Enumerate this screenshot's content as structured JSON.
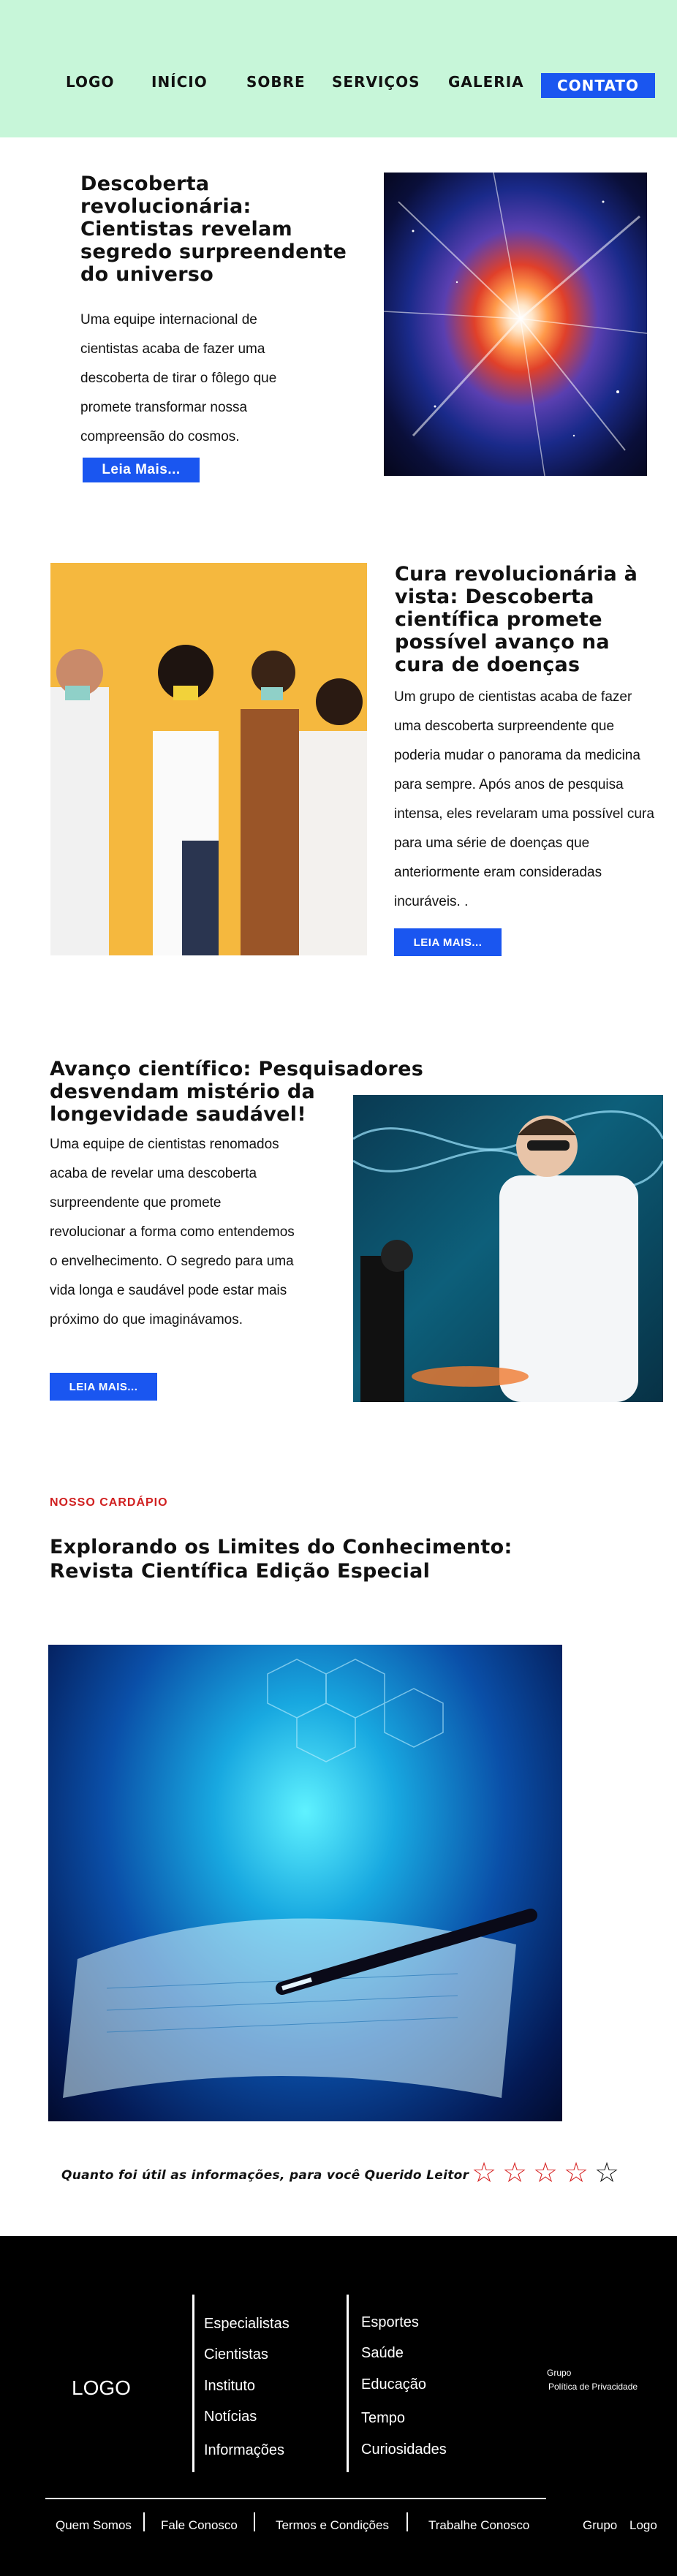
{
  "nav": {
    "logo": "LOGO",
    "items": [
      "INÍCIO",
      "SOBRE",
      "SERVIÇOS",
      "GALERIA"
    ],
    "cta": "CONTATO"
  },
  "articles": [
    {
      "title": "Descoberta revolucionária: Cientistas revelam segredo surpreendente do universo",
      "body": "Uma equipe internacional de cientistas acaba de fazer uma descoberta de tirar o fôlego que promete transformar nossa compreensão do cosmos.",
      "button": "Leia Mais..."
    },
    {
      "title": "Cura revolucionária à vista: Descoberta científica promete possível avanço na cura de doenças",
      "body": "Um grupo de cientistas acaba de fazer uma descoberta surpreendente que poderia mudar o panorama da medicina para sempre. Após anos de pesquisa intensa, eles revelaram uma possível cura para uma série de doenças que anteriormente eram consideradas incuráveis. .",
      "button": "LEIA MAIS..."
    },
    {
      "title": "Avanço científico: Pesquisadores desvendam mistério da longevidade saudável!",
      "body": "Uma equipe de cientistas renomados acaba de revelar uma descoberta surpreendente que promete revolucionar a forma como entendemos o envelhecimento. O segredo para uma vida longa e saudável pode estar mais próximo do que imaginávamos.",
      "button": "LEIA MAIS..."
    }
  ],
  "feature": {
    "kicker": "NOSSO CARDÁPIO",
    "title": "Explorando os Limites do Conhecimento: Revista Científica Edição Especial"
  },
  "rating": {
    "label": "Quanto foi útil as informações, para você Querido Leitor",
    "value": 4,
    "max": 5,
    "filled_color": "#d62020",
    "empty_color": "#111111"
  },
  "footer": {
    "logo": "LOGO",
    "col1": [
      "Especialistas",
      "Cientistas",
      "Instituto",
      "Notícias",
      "Informações"
    ],
    "col2": [
      "Esportes",
      "Saúde",
      "Educação",
      "Tempo",
      "Curiosidades"
    ],
    "small": [
      "Grupo",
      "Política de Privacidade"
    ],
    "bottom": [
      "Quem Somos",
      "Fale Conosco",
      "Termos e Condições",
      "Trabalhe Conosco"
    ],
    "bottom_right": [
      "Grupo",
      "Logo"
    ]
  },
  "colors": {
    "header_bg": "#c7f6d9",
    "accent": "#1a56f0",
    "kicker": "#d02020",
    "footer_bg": "#000000"
  }
}
